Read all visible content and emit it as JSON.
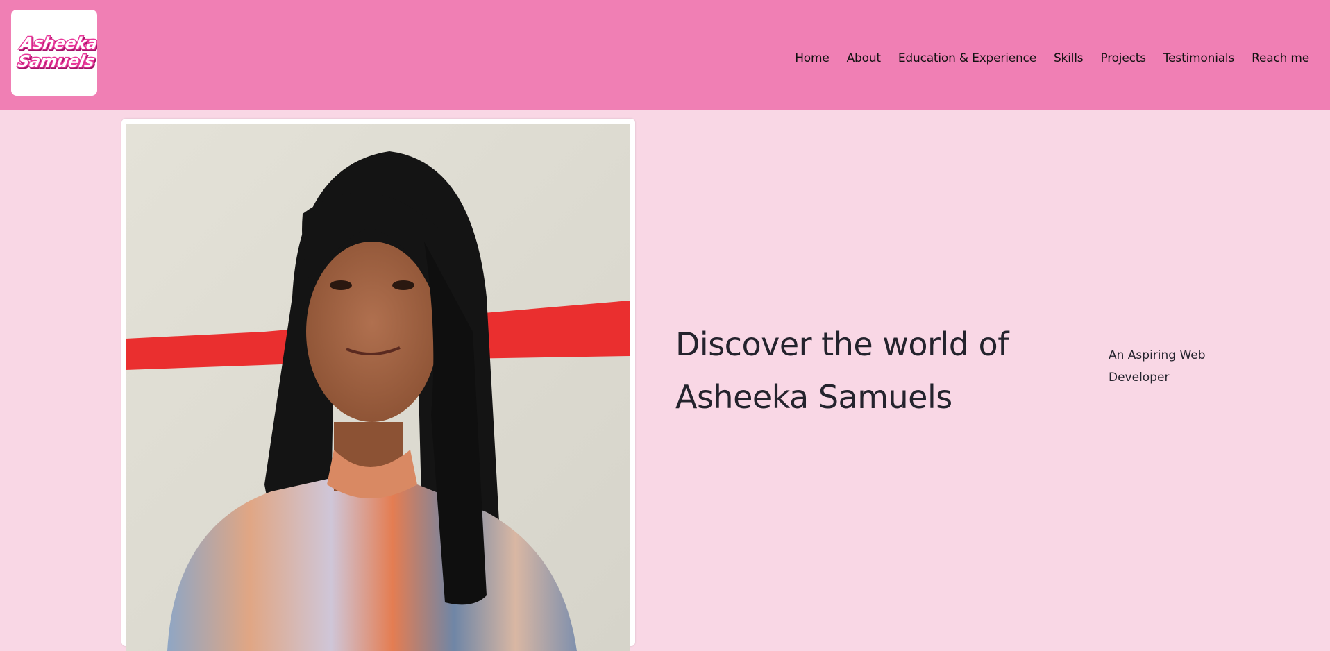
{
  "header": {
    "logo": {
      "text_line1": "Asheeka",
      "text_line2": "Samuels",
      "color": "#e8389a"
    },
    "nav": [
      {
        "label": "Home"
      },
      {
        "label": "About"
      },
      {
        "label": "Education & Experience"
      },
      {
        "label": "Skills"
      },
      {
        "label": "Projects"
      },
      {
        "label": "Testimonials"
      },
      {
        "label": "Reach me"
      }
    ],
    "background": "#f07fb4"
  },
  "hero": {
    "title_line1": "Discover the world of",
    "title_line2": "Asheeka Samuels",
    "subtitle": "An Aspiring Web Developer",
    "photo_alt": "portrait-photo"
  },
  "colors": {
    "page_background": "#f9d7e5",
    "text": "#24232d",
    "accent": "#e8389a"
  }
}
